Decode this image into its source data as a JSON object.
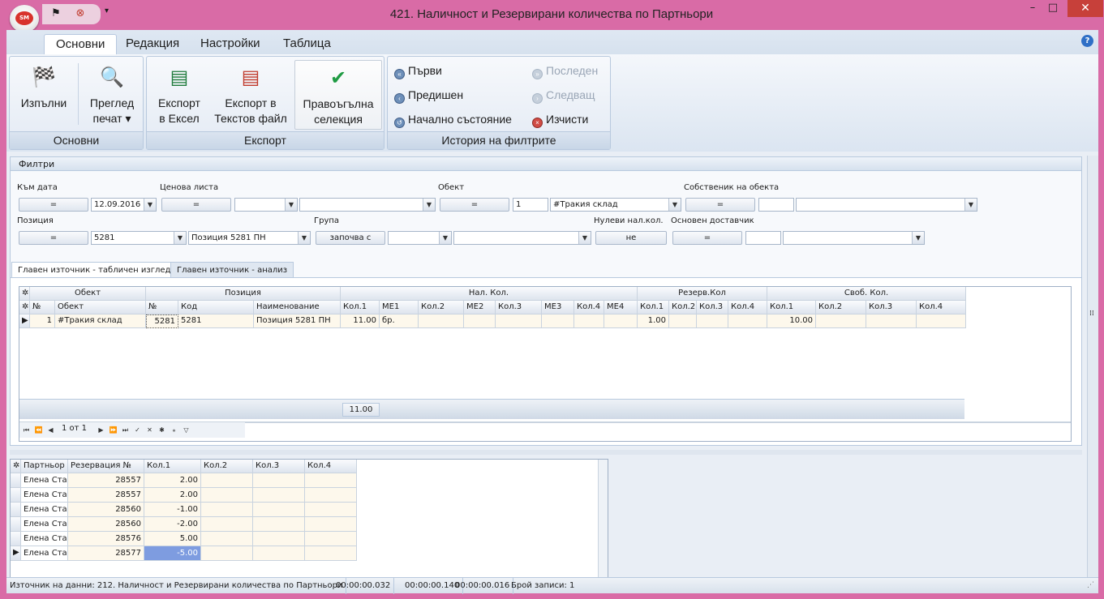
{
  "title": "421. Наличност и Резервирани количества по Партньори",
  "logo": "SM",
  "ribbon_tabs": [
    "Основни",
    "Редакция",
    "Настройки",
    "Таблица"
  ],
  "groups": {
    "main": {
      "label": "Основни",
      "execute": "Изпълни",
      "preview1": "Преглед",
      "preview2": "печат ▾"
    },
    "export": {
      "label": "Експорт",
      "excel1": "Експорт",
      "excel2": "в Ексел",
      "text1": "Експорт в",
      "text2": "Текстов файл",
      "rect1": "Правоъгълна",
      "rect2": "селекция"
    },
    "history": {
      "label": "История на филтрите",
      "first": "Първи",
      "last": "Последен",
      "prev": "Предишен",
      "next": "Следващ",
      "initial": "Начално състояние",
      "clear": "Изчисти"
    }
  },
  "filters": {
    "title": "Филтри",
    "to_date_label": "Към дата",
    "to_date_op": "=",
    "to_date_value": "12.09.2016",
    "price_list_label": "Ценова листа",
    "price_list_op": "=",
    "object_label": "Обект",
    "object_op": "=",
    "object_code": "1",
    "object_name": "#Тракия склад",
    "owner_label": "Собственик на обекта",
    "owner_op": "=",
    "position_label": "Позиция",
    "position_op": "=",
    "position_code": "5281",
    "position_name": "Позиция 5281 ПН",
    "group_label": "Група",
    "group_op": "започва с",
    "zero_label": "Нулеви нал.кол.",
    "zero_value": "не",
    "supplier_label": "Основен доставчик",
    "supplier_op": "="
  },
  "grid_tabs": [
    "Главен източник - табличен изглед",
    "Главен източник - анализ"
  ],
  "grid": {
    "band_headers": [
      "Обект",
      "Позиция",
      "Нал. Кол.",
      "Резерв.Кол",
      "Своб. Кол."
    ],
    "columns": [
      "№",
      "Обект",
      "№",
      "Код",
      "Наименование",
      "Кол.1",
      "МЕ1",
      "Кол.2",
      "МЕ2",
      "Кол.3",
      "МЕ3",
      "Кол.4",
      "МЕ4",
      "Кол.1",
      "Кол.2",
      "Кол.3",
      "Кол.4",
      "Кол.1",
      "Кол.2",
      "Кол.3",
      "Кол.4"
    ],
    "rows": [
      [
        "1",
        "#Тракия склад",
        "5281",
        "5281",
        "Позиция 5281 ПН",
        "11.00",
        "бр.",
        "",
        "",
        "",
        "",
        "",
        "",
        "1.00",
        "",
        "",
        "",
        "10.00",
        "",
        "",
        ""
      ]
    ],
    "footer_total": "11.00",
    "nav_text": "1 от 1"
  },
  "detail": {
    "columns": [
      "Партньор",
      "Резервация №",
      "Кол.1",
      "Кол.2",
      "Кол.3",
      "Кол.4"
    ],
    "rows": [
      [
        "Елена Ставрева",
        "28557",
        "2.00",
        "",
        "",
        ""
      ],
      [
        "Елена Ставрева",
        "28557",
        "2.00",
        "",
        "",
        ""
      ],
      [
        "Елена Ставрева",
        "28560",
        "-1.00",
        "",
        "",
        ""
      ],
      [
        "Елена Ставрева",
        "28560",
        "-2.00",
        "",
        "",
        ""
      ],
      [
        "Елена Ставрева",
        "28576",
        "5.00",
        "",
        "",
        ""
      ],
      [
        "Елена Ставрева",
        "28577",
        "-5.00",
        "",
        "",
        ""
      ]
    ]
  },
  "status": {
    "source": "Източник на данни: 212. Наличност и Резервирани количества по Партньори",
    "t1": "00:00:00.032",
    "t2": "00:00:00.140",
    "t3": "00:00:00.016",
    "records": "Брой записи: 1"
  }
}
